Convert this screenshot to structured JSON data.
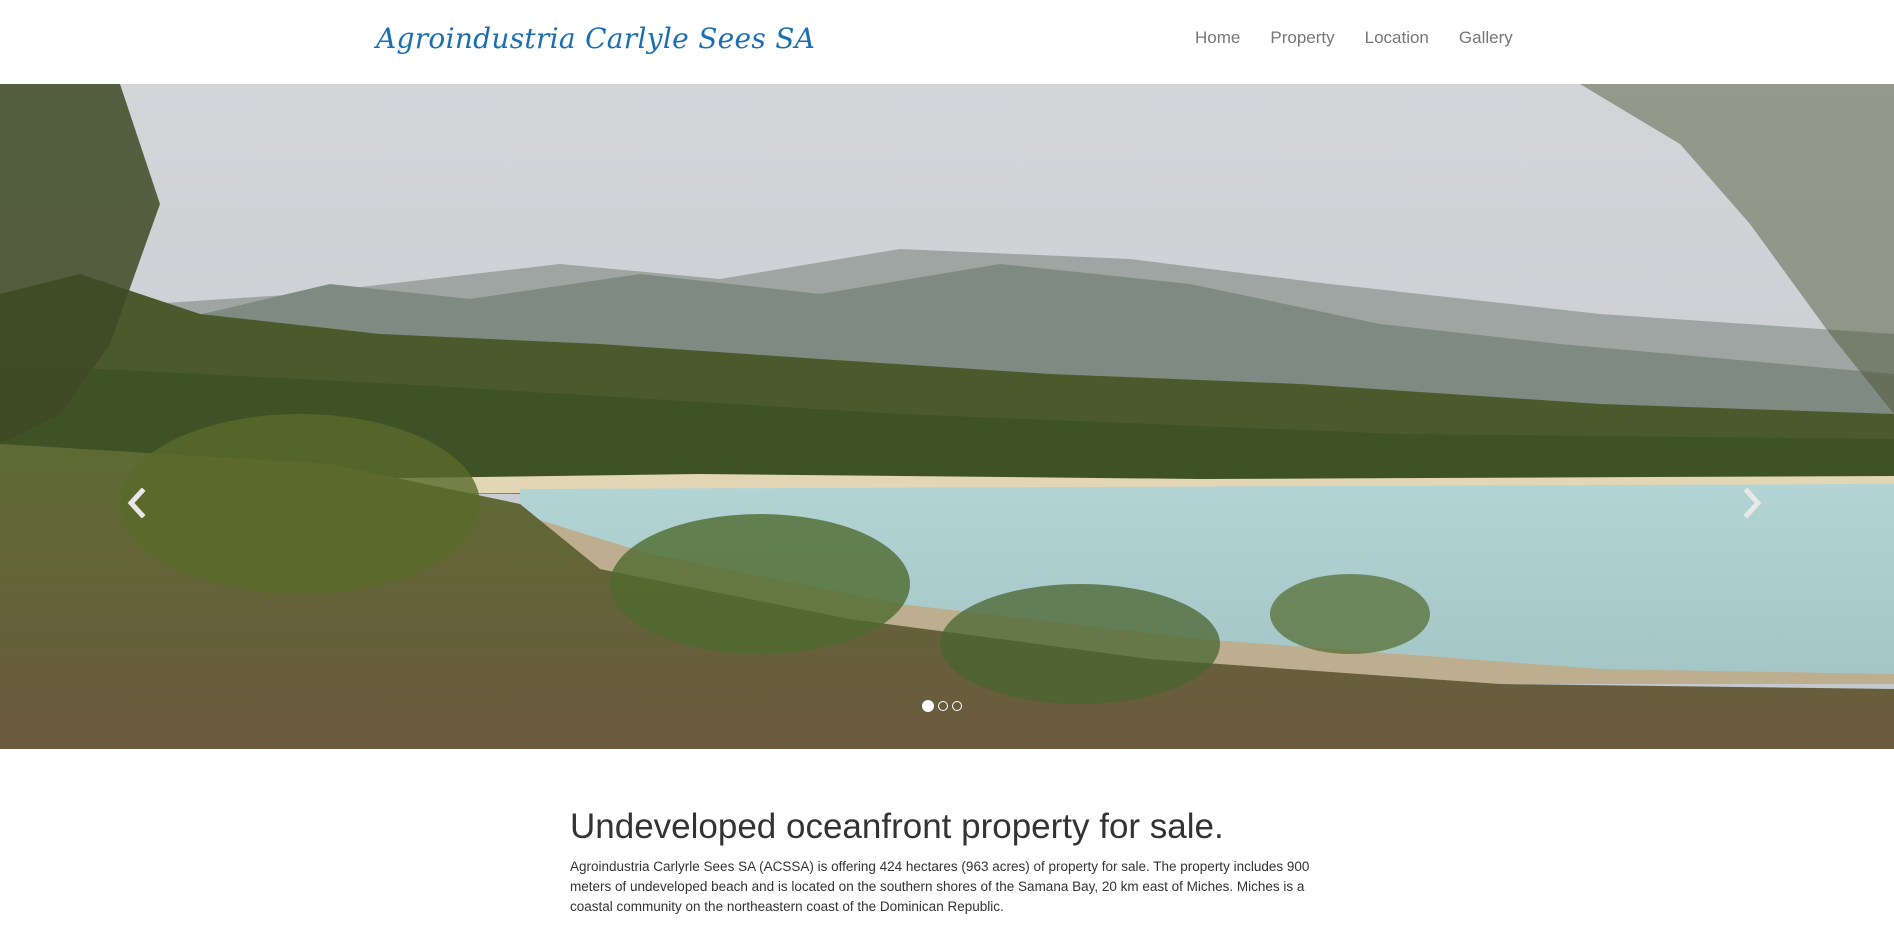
{
  "brand": {
    "name": "Agroindustria Carlyle Sees SA"
  },
  "nav": {
    "items": [
      {
        "label": "Home"
      },
      {
        "label": "Property"
      },
      {
        "label": "Location"
      },
      {
        "label": "Gallery"
      }
    ]
  },
  "carousel": {
    "prev_icon": "chevron-left-icon",
    "next_icon": "chevron-right-icon",
    "slide_count": 3,
    "active_slide": 1
  },
  "main": {
    "heading": "Undeveloped oceanfront property for sale.",
    "body": "Agroindustria Carlyrle Sees SA (ACSSA) is offering 424 hectares (963 acres) of property for sale. The property includes 900 meters of undeveloped beach and is located on the southern shores of the Samana Bay, 20 km east of Miches. Miches is a coastal community on the northeastern coast of the Dominican Republic."
  },
  "colors": {
    "brand": "#1a6fb0",
    "nav_text": "#777777",
    "heading": "#333333"
  }
}
